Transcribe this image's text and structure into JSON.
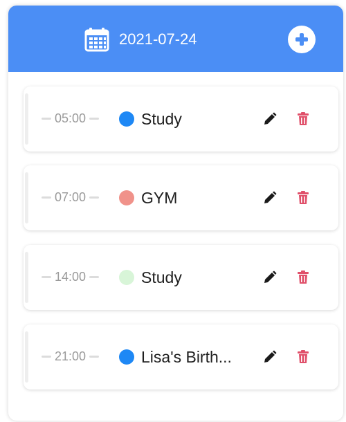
{
  "header": {
    "date": "2021-07-24",
    "icons": {
      "calendar": "calendar-icon",
      "add": "plus-circle-icon"
    },
    "accent_color": "#4b8ef5"
  },
  "events": [
    {
      "time": "05:00",
      "title": "Study",
      "color": "#1e88f5"
    },
    {
      "time": "07:00",
      "title": "GYM",
      "color": "#f0928a"
    },
    {
      "time": "14:00",
      "title": "Study",
      "color": "#d8f5d8"
    },
    {
      "time": "21:00",
      "title": "Lisa's Birth...",
      "color": "#1e88f5"
    }
  ],
  "row_icons": {
    "edit": "pencil-icon",
    "delete": "trash-icon"
  },
  "colors": {
    "edit": "#1a1a1a",
    "delete": "#e0506a"
  }
}
